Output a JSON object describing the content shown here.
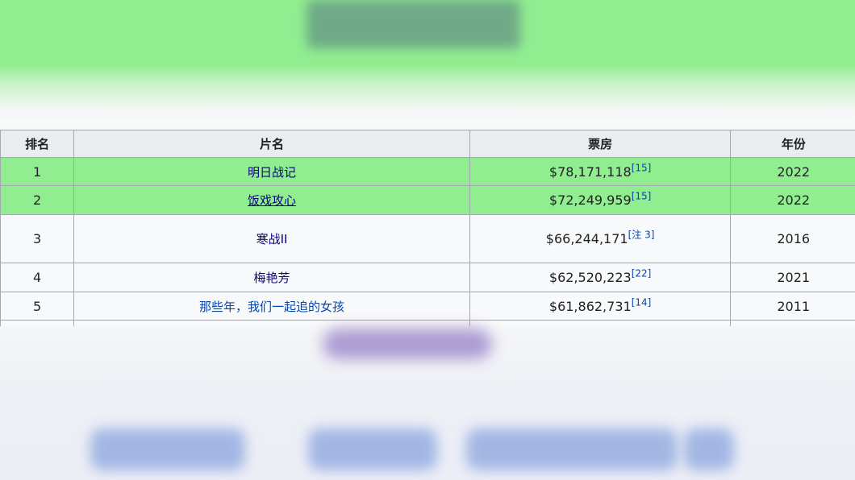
{
  "table": {
    "headers": {
      "rank": "排名",
      "title": "片名",
      "gross": "票房",
      "year": "年份"
    },
    "rows": [
      {
        "rank": "1",
        "title": "明日战记",
        "gross": "$78,171,118",
        "ref": "[15]",
        "year": "2022",
        "highlight": true
      },
      {
        "rank": "2",
        "title": "饭戏攻心",
        "gross": "$72,249,959",
        "ref": "[15]",
        "year": "2022",
        "highlight": true
      },
      {
        "rank": "3",
        "title": "寒战II",
        "gross": "$66,244,171",
        "ref": "[注 3]",
        "year": "2016",
        "highlight": false
      },
      {
        "rank": "4",
        "title": "梅艳芳",
        "gross": "$62,520,223",
        "ref": "[22]",
        "year": "2021",
        "highlight": false
      },
      {
        "rank": "5",
        "title": "那些年，我们一起追的女孩",
        "gross": "$61,862,731",
        "ref": "[14]",
        "year": "2011",
        "highlight": false
      }
    ]
  },
  "colors": {
    "highlight": "#90ee90",
    "link": "#0645ad",
    "header_bg": "#eaecf0",
    "border": "#a2a9b1"
  }
}
